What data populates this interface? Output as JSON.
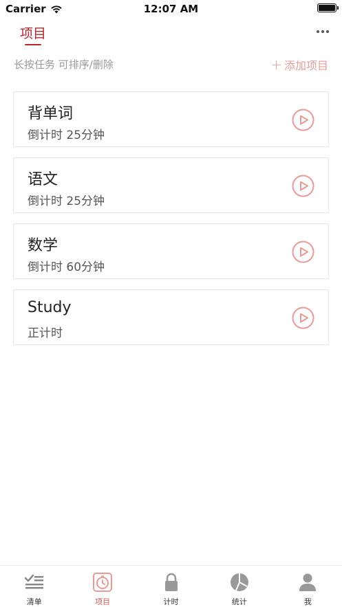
{
  "status_bar": {
    "carrier": "Carrier",
    "time": "12:07 AM"
  },
  "header": {
    "title": "项目",
    "title_color": "#b7262c"
  },
  "subbar": {
    "hint": "长按任务 可排序/删除",
    "add_label": "添加项目",
    "add_icon": "plus-icon",
    "add_color": "#e59f9a"
  },
  "projects": [
    {
      "name": "背单词",
      "meta": "倒计时  25分钟"
    },
    {
      "name": "语文",
      "meta": "倒计时  25分钟"
    },
    {
      "name": "数学",
      "meta": "倒计时  60分钟"
    },
    {
      "name": "Study",
      "meta": "正计时"
    }
  ],
  "play_icon_color": "#e89a96",
  "tabs": [
    {
      "label": "清单",
      "icon": "checklist-icon",
      "active": false
    },
    {
      "label": "项目",
      "icon": "timer-icon",
      "active": true
    },
    {
      "label": "计时",
      "icon": "lock-icon",
      "active": false
    },
    {
      "label": "统计",
      "icon": "pie-chart-icon",
      "active": false
    },
    {
      "label": "我",
      "icon": "person-icon",
      "active": false
    }
  ]
}
